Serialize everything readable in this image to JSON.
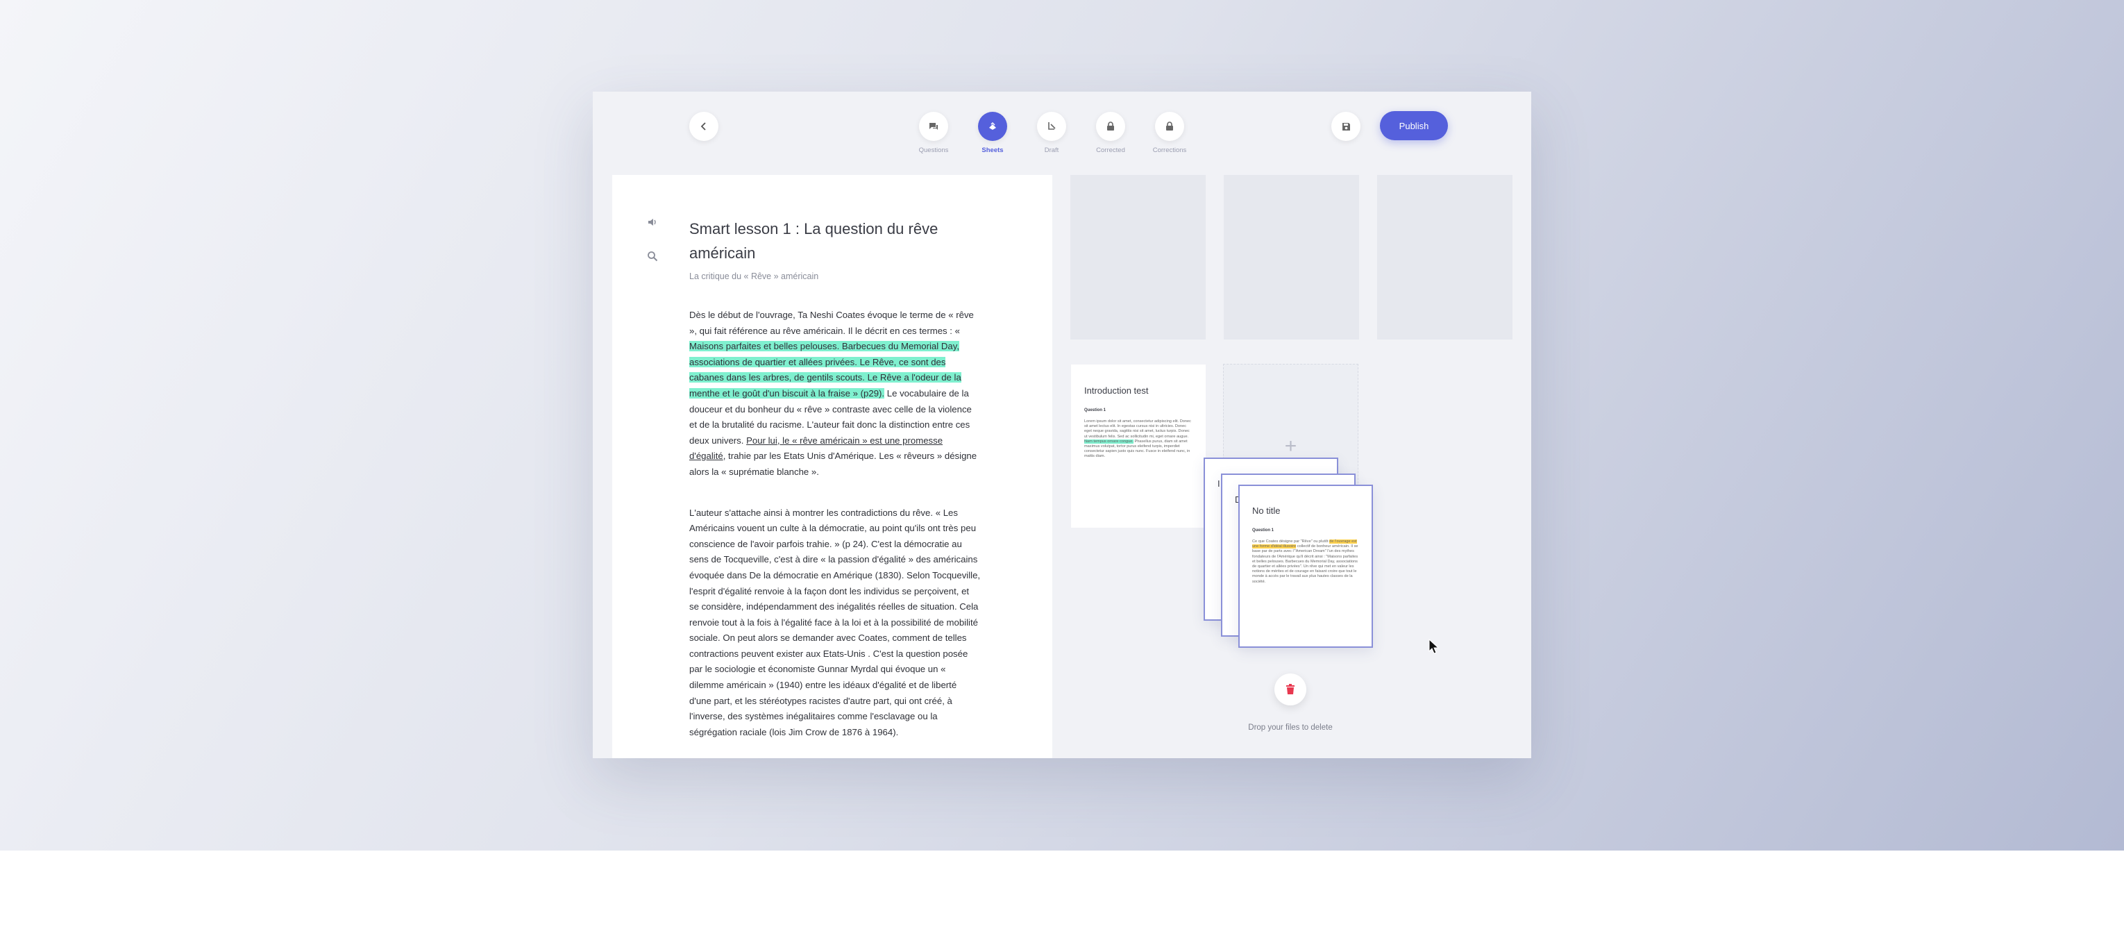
{
  "toolbar": {
    "back_icon": "chevron-left-icon",
    "steps": [
      {
        "label": "Questions",
        "icon": "chat-icon",
        "active": false
      },
      {
        "label": "Sheets",
        "icon": "sheets-icon",
        "active": true
      },
      {
        "label": "Draft",
        "icon": "draft-icon",
        "active": false
      },
      {
        "label": "Corrected",
        "icon": "lock-icon",
        "active": false
      },
      {
        "label": "Corrections",
        "icon": "lock-icon",
        "active": false
      }
    ],
    "save_icon": "save-icon",
    "publish_label": "Publish"
  },
  "document": {
    "title": "Smart lesson 1 : La question du rêve américain",
    "subtitle": "La critique du « Rêve » américain",
    "para1": {
      "before": "Dès le début de l'ouvrage, Ta Neshi Coates évoque le terme de « rêve », qui fait référence au rêve américain. Il le décrit en ces termes : « ",
      "highlight": "Maisons parfaites et belles pelouses. Barbecues du Memorial Day, associations de quartier et allées privées. Le Rêve, ce sont des cabanes dans les arbres, de gentils scouts. Le Rêve a l'odeur de la menthe et le goût d'un biscuit à la fraise » (p29).",
      "middle": " Le vocabulaire de la douceur et du bonheur du « rêve » contraste avec celle de la violence et de la brutalité du racisme. L'auteur fait donc la distinction entre ces deux univers. ",
      "underline": "Pour lui, le « rêve américain » est une promesse d'égalité",
      "after": ", trahie par les Etats Unis d'Amérique. Les « rêveurs » désigne alors la « suprématie blanche »."
    },
    "para2": "L'auteur s'attache ainsi à montrer les contradictions du rêve. « Les Américains vouent un culte à la démocratie, au point qu'ils ont très peu conscience de l'avoir parfois trahie. » (p 24). C'est la démocratie au sens de Tocqueville, c'est à dire « la passion d'égalité » des américains évoquée dans De la démocratie en Amérique (1830). Selon Tocqueville, l'esprit d'égalité renvoie à la façon dont les individus se perçoivent, et se considère, indépendamment des inégalités réelles de situation. Cela renvoie tout à la fois à l'égalité face à la loi et à la possibilité de mobilité sociale. On peut alors se demander avec Coates, comment de telles contractions peuvent exister aux Etats-Unis . C'est la question posée par le sociologie et économiste Gunnar Myrdal qui évoque un « dilemme américain » (1940) entre les idéaux d'égalité et de liberté d'une part, et les stéréotypes racistes d'autre part, qui ont créé, à l'inverse, des systèmes inégalitaires comme l'esclavage ou la ségrégation raciale (lois Jim Crow de 1876 à 1964)."
  },
  "cards": {
    "intro": {
      "title": "Introduction test",
      "question": "Question 1",
      "text_a": "Lorem ipsum dolor sit amet, consectetur adipiscing elit. Donec sit amet lectus elit. In egestas cursus nisi in ultricies. Donec eget neque gravida, sagittis nisi sit amet, luctus turpis. Donec ut vestibulum felis. Sed ac sollicitudin mi, eget ornare augue. ",
      "text_hl": "Nam tempus ornare congue.",
      "text_b": " Phasellus purus, diam sit amet maximus volutpat, tortor purus eleifend turpis, imperdiet consectetur sapien justo quis nunc. Fusce in eleifend nunc, in mattis diam."
    },
    "stack_back_titles": [
      "I",
      "D"
    ],
    "front": {
      "title": "No title",
      "question": "Question 1",
      "text_a": "Ce que Coates désigne par \"Rêve\" ou plutôt ",
      "text_hl": "de l'ouvrage est une forme d'idéal illusoire",
      "text_b": " collectif de bonheur américain. Il se base par de parts avec l'\"American Dream\" l'un des mythes fondateurs de l'Amérique qu'il décrit ainsi : \"Maisons parfaites et belles pelouses. Barbecues du Memorial Day, associations de quartier et allées privées\". Un rêve qui met en valeur les notions de mérites et de courage en faisant croire que tout le monde à accès par le travail aux plus hautes classes de la société."
    }
  },
  "trash": {
    "icon": "trash-icon",
    "drop_label": "Drop your files to delete"
  },
  "colors": {
    "accent": "#5560dc",
    "highlight_green": "#7ff0cf",
    "highlight_yellow": "#ffd24d",
    "danger": "#e8384f"
  }
}
